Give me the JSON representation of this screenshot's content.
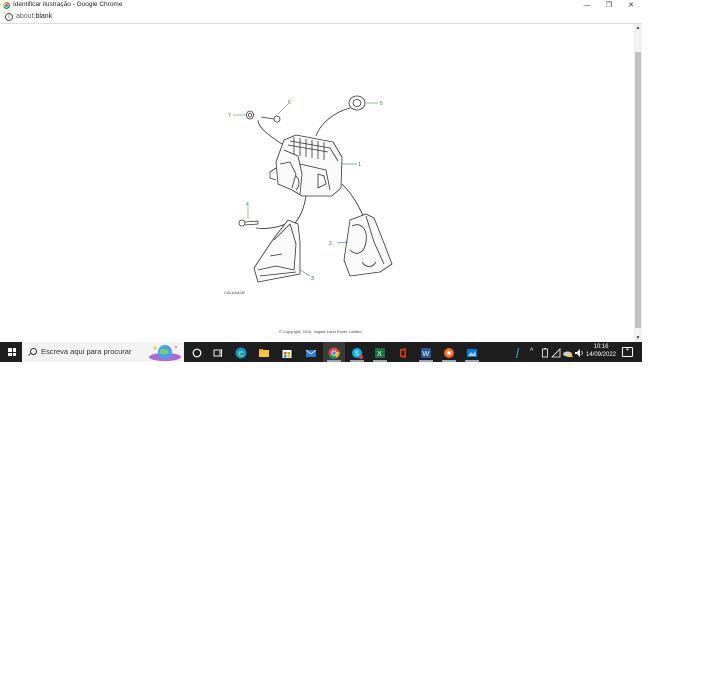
{
  "window": {
    "title": "Identificar ilustração - Google Chrome",
    "minimize": "—",
    "restore": "❐",
    "close": "✕"
  },
  "address_bar": {
    "scheme": "about:",
    "path": "blank"
  },
  "illustration": {
    "callouts": [
      "1",
      "2",
      "3",
      "4",
      "5",
      "6",
      "7"
    ],
    "figure_code": "CALAAA1B",
    "copyright": "© Copyright, 2016, Jaguar Land Rover Limited"
  },
  "taskbar": {
    "search_placeholder": "Escreva aqui para procurar",
    "time": "10:16",
    "date": "14/09/2022",
    "notification_count": "4"
  },
  "colors": {
    "callout_green": "#2e7d32",
    "callout_blue": "#1a4a9c",
    "taskbar_bg": "#1e1e1e"
  }
}
